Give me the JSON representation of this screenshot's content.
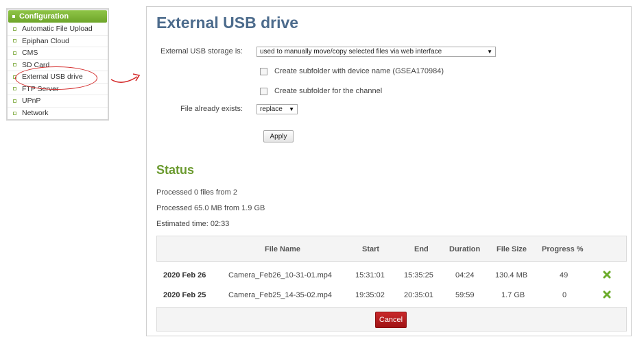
{
  "menu": {
    "header": "Configuration",
    "items": [
      {
        "label": "Automatic File Upload"
      },
      {
        "label": "Epiphan Cloud"
      },
      {
        "label": "CMS"
      },
      {
        "label": "SD Card"
      },
      {
        "label": "External USB drive"
      },
      {
        "label": "FTP Server"
      },
      {
        "label": "UPnP"
      },
      {
        "label": "Network"
      }
    ]
  },
  "page": {
    "title": "External USB drive",
    "storage_label": "External USB storage is:",
    "storage_value": "used to manually move/copy selected files via web interface",
    "subfolder_device_label": "Create subfolder with device name (GSEA170984)",
    "subfolder_channel_label": "Create subfolder for the channel",
    "file_exists_label": "File already exists:",
    "file_exists_value": "replace",
    "apply_label": "Apply"
  },
  "status": {
    "title": "Status",
    "processed_files": "Processed 0 files from 2",
    "processed_size": "Processed 65.0 MB from 1.9 GB",
    "estimated_time": "Estimated time: 02:33"
  },
  "table": {
    "headers": [
      "File Name",
      "Start",
      "End",
      "Duration",
      "File Size",
      "Progress %"
    ],
    "rows": [
      {
        "date": "2020 Feb 26",
        "file": "Camera_Feb26_10-31-01.mp4",
        "start": "15:31:01",
        "end": "15:35:25",
        "duration": "04:24",
        "size": "130.4 MB",
        "progress": "49"
      },
      {
        "date": "2020 Feb 25",
        "file": "Camera_Feb25_14-35-02.mp4",
        "start": "19:35:02",
        "end": "20:35:01",
        "duration": "59:59",
        "size": "1.7 GB",
        "progress": "0"
      }
    ],
    "cancel_label": "Cancel"
  },
  "colors": {
    "accent_green": "#7fb636",
    "title_blue": "#4c6b8c",
    "status_green": "#6a9a2e",
    "cancel_red": "#b51c1e",
    "annotation_red": "#d42a2a"
  }
}
